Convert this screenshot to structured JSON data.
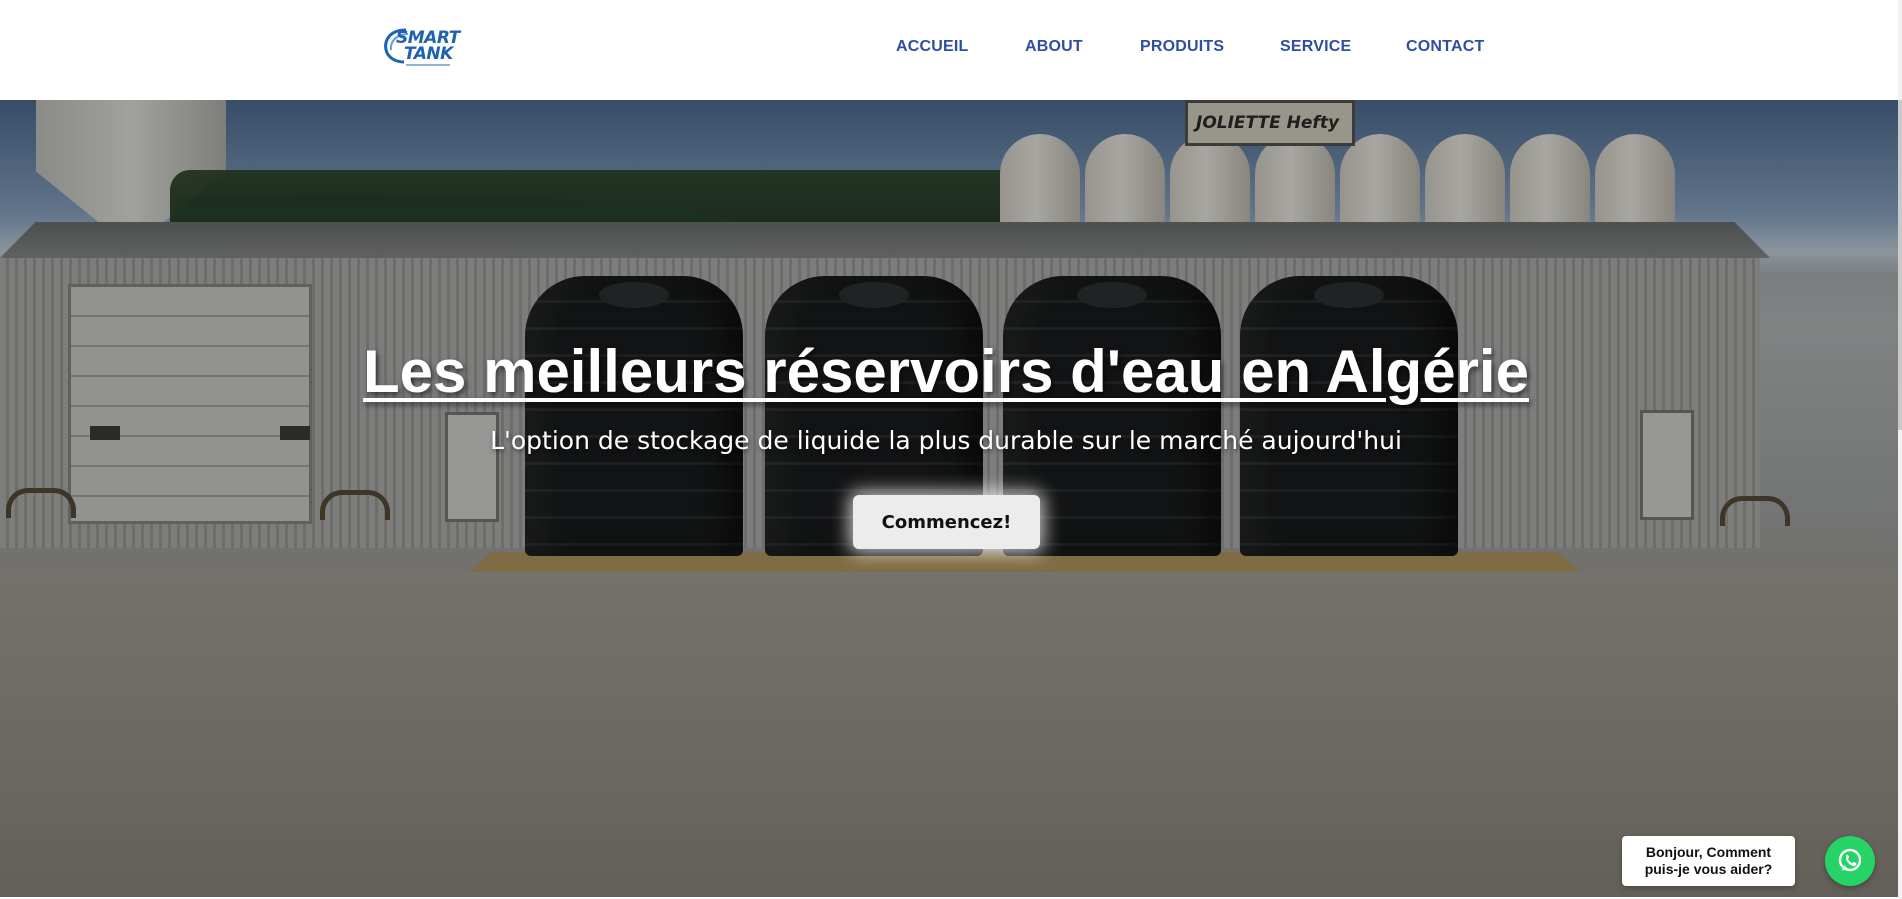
{
  "logo": {
    "line1": "SMART",
    "line2": "TANK"
  },
  "nav": {
    "items": [
      {
        "label": "ACCUEIL"
      },
      {
        "label": "ABOUT"
      },
      {
        "label": "PRODUITS"
      },
      {
        "label": "SERVICE"
      },
      {
        "label": "CONTACT"
      }
    ]
  },
  "hero": {
    "title": "Les meilleurs réservoirs d'eau en Algérie",
    "subtitle": "L'option de stockage de liquide la plus durable sur le marché aujourd'hui",
    "cta_label": "Commencez!",
    "background_sign": "JOLIETTE Hefty"
  },
  "chat": {
    "bubble_text": "Bonjour, Comment puis-je vous aider?",
    "icon": "whatsapp-icon"
  },
  "colors": {
    "nav_text": "#2f4f9e",
    "logo_blue": "#1d63b0",
    "chat_green": "#25d366",
    "hero_text": "#ffffff"
  }
}
